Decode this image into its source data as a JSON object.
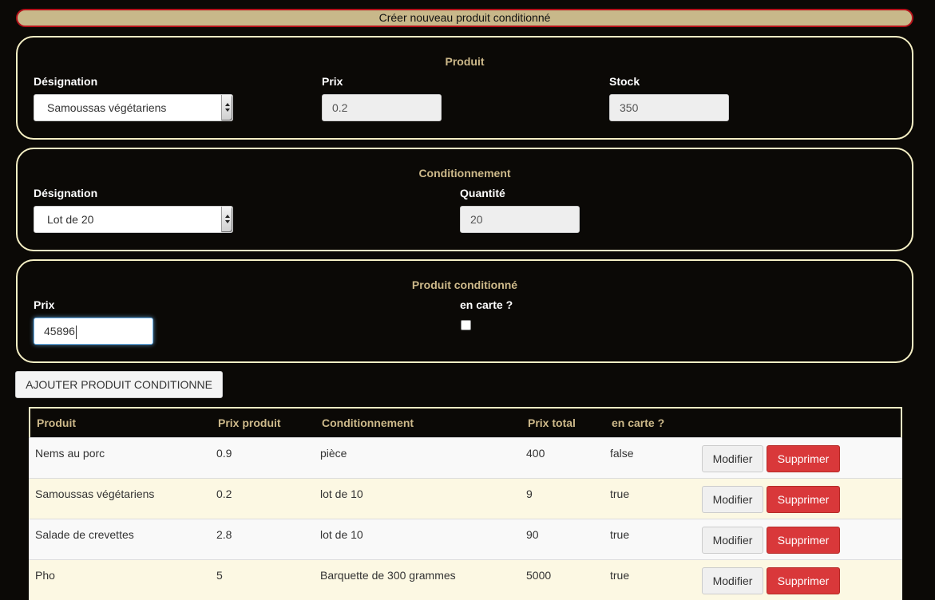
{
  "banner": {
    "title": "Créer nouveau produit conditionné"
  },
  "produit_panel": {
    "title": "Produit",
    "designation_label": "Désignation",
    "designation_value": "Samoussas végétariens",
    "prix_label": "Prix",
    "prix_value": "0.2",
    "stock_label": "Stock",
    "stock_value": "350"
  },
  "conditionnement_panel": {
    "title": "Conditionnement",
    "designation_label": "Désignation",
    "designation_value": "Lot de 20",
    "quantite_label": "Quantité",
    "quantite_value": "20"
  },
  "produit_conditionne_panel": {
    "title": "Produit conditionné",
    "prix_label": "Prix",
    "prix_value": "45896",
    "en_carte_label": "en carte ?",
    "en_carte_checked": false
  },
  "add_button": {
    "label": "AJOUTER PRODUIT CONDITIONNE"
  },
  "table": {
    "headers": [
      "Produit",
      "Prix produit",
      "Conditionnement",
      "Prix total",
      "en carte ?"
    ],
    "rows": [
      {
        "produit": "Nems au porc",
        "prix": "0.9",
        "conditionnement": "pièce",
        "total": "400",
        "carte": "false"
      },
      {
        "produit": "Samoussas végétariens",
        "prix": "0.2",
        "conditionnement": "lot de 10",
        "total": "9",
        "carte": "true"
      },
      {
        "produit": "Salade de crevettes",
        "prix": "2.8",
        "conditionnement": "lot de 10",
        "total": "90",
        "carte": "true"
      },
      {
        "produit": "Pho",
        "prix": "5",
        "conditionnement": "Barquette de 300 grammes",
        "total": "5000",
        "carte": "true"
      }
    ],
    "modify_label": "Modifier",
    "delete_label": "Supprimer"
  }
}
